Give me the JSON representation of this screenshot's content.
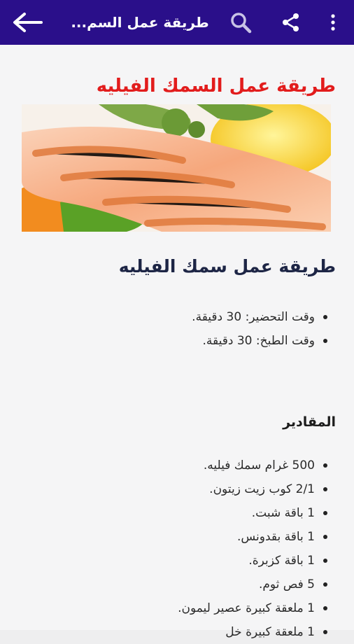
{
  "appbar": {
    "title": "طريقة عمل السم...",
    "back_icon": "arrow-back-icon",
    "search_icon": "search-icon",
    "share_icon": "share-icon",
    "menu_icon": "more-vert-icon",
    "colors": {
      "bar": "#2a0f8a",
      "icons": "#ffffff"
    }
  },
  "article": {
    "title": "طريقة عمل السمك الفيليه",
    "title_color": "#e21c1c",
    "image_alt": "grilled-salmon-fillet",
    "heading": "طريقة عمل سمك الفيليه",
    "times": [
      "وقت التحضير: 30 دقيقة.",
      "وقت الطبخ: 30 دقيقة."
    ],
    "ingredients_heading": "المقادير",
    "ingredients": [
      "500 غرام سمك فيليه.",
      "2/1 كوب زيت زيتون.",
      "1 باقة شبت.",
      "1 باقة بقدونس.",
      "1 باقة كزبرة.",
      "5 فص ثوم.",
      "1 ملعقة كبيرة عصير ليمون.",
      "1 ملعقة كبيرة خل"
    ]
  }
}
